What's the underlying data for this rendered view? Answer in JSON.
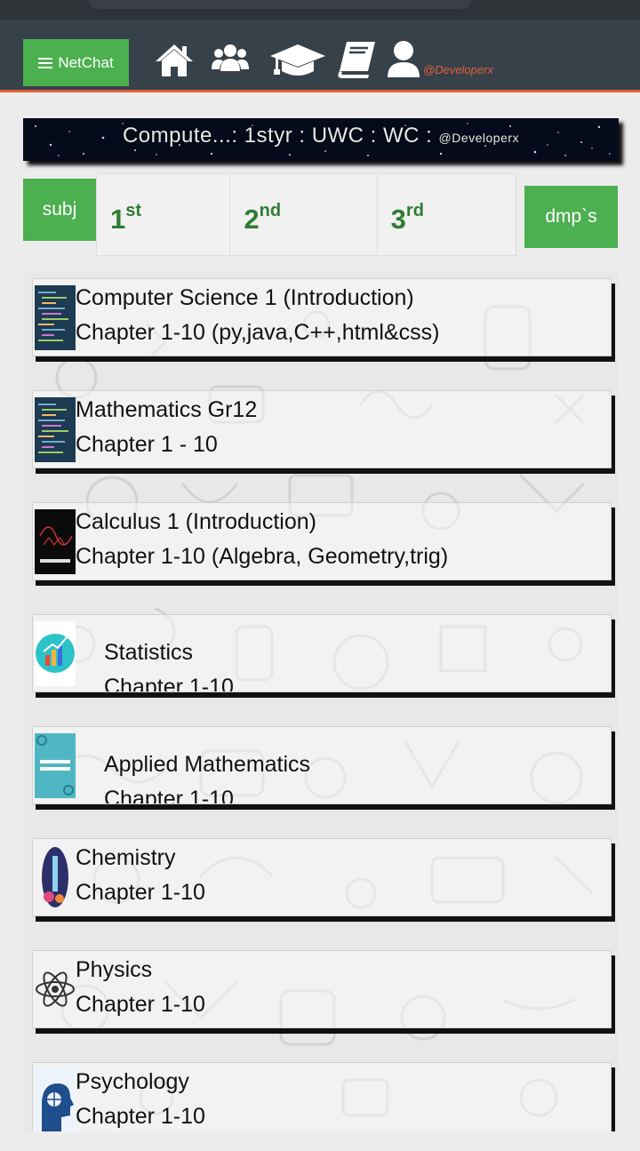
{
  "nav": {
    "brand": "NetChat",
    "handle": "@Developerx",
    "icons": [
      "home-icon",
      "users-icon",
      "graduation-cap-icon",
      "book-icon",
      "user-icon"
    ]
  },
  "banner": {
    "text": "Compute...: 1styr : UWC : WC :",
    "handle": "@Developerx"
  },
  "tabs": {
    "subj": "subj",
    "years": [
      {
        "num": "1",
        "suffix": "st"
      },
      {
        "num": "2",
        "suffix": "nd"
      },
      {
        "num": "3",
        "suffix": "rd"
      }
    ],
    "dmps": "dmp`s"
  },
  "courses": [
    {
      "title": "Computer Science 1 (Introduction)",
      "subtitle": "Chapter 1-10 (py,java,C++,html&css)",
      "thumb": "code-thumbnail"
    },
    {
      "title": "Mathematics Gr12",
      "subtitle": "Chapter 1 - 10",
      "thumb": "code-thumbnail"
    },
    {
      "title": "Calculus 1 (Introduction)",
      "subtitle": "Chapter 1-10 (Algebra, Geometry,trig)",
      "thumb": "calculus-thumbnail"
    },
    {
      "title": "Statistics",
      "subtitle": "Chapter 1-10",
      "thumb": "statistics-chart-thumbnail"
    },
    {
      "title": "Applied Mathematics",
      "subtitle": "Chapter 1-10",
      "thumb": "applied-mathematics-thumbnail"
    },
    {
      "title": "Chemistry",
      "subtitle": "Chapter 1-10",
      "thumb": "chemistry-flask-thumbnail"
    },
    {
      "title": "Physics",
      "subtitle": "Chapter 1-10",
      "thumb": "atom-thumbnail"
    },
    {
      "title": "Psychology",
      "subtitle": "Chapter 1-10",
      "thumb": "brain-head-thumbnail"
    }
  ],
  "colors": {
    "accent_green": "#4caf50",
    "tab_text_green": "#2e7d32",
    "navbar": "#36414a",
    "navbar_underline": "#e2603a"
  }
}
